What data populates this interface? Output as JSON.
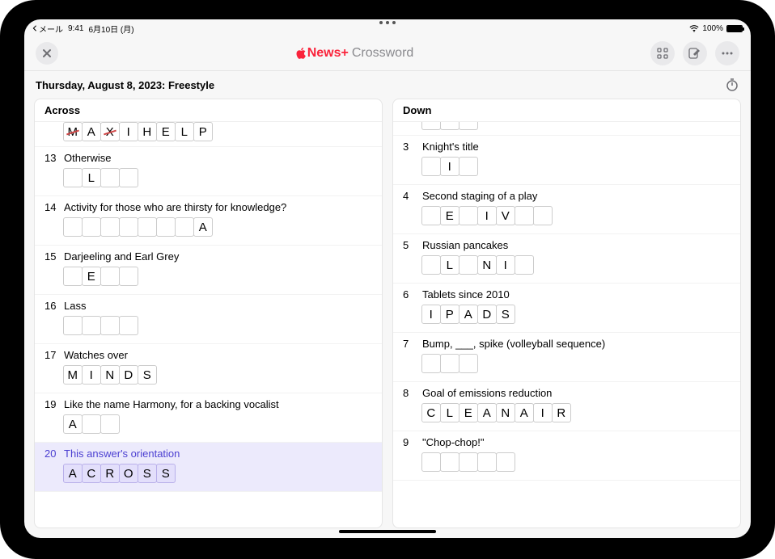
{
  "status": {
    "back_label": "メール",
    "time": "9:41",
    "date": "6月10日 (月)",
    "battery": "100%"
  },
  "nav": {
    "brand": "News+",
    "brand_sub": "Crossword"
  },
  "subtitle": "Thursday, August 8, 2023: Freestyle",
  "across": {
    "header": "Across",
    "clues": [
      {
        "num": "",
        "text": "",
        "letters": [
          "M",
          "A",
          "X",
          "I",
          "H",
          "E",
          "L",
          "P"
        ],
        "struck": [
          0,
          2
        ],
        "nohdr": true
      },
      {
        "num": "13",
        "text": "Otherwise",
        "letters": [
          "",
          "L",
          "",
          ""
        ]
      },
      {
        "num": "14",
        "text": "Activity for those who are thirsty for knowledge?",
        "letters": [
          "",
          "",
          "",
          "",
          "",
          "",
          "",
          "A"
        ]
      },
      {
        "num": "15",
        "text": "Darjeeling and Earl Grey",
        "letters": [
          "",
          "E",
          "",
          ""
        ]
      },
      {
        "num": "16",
        "text": "Lass",
        "letters": [
          "",
          "",
          "",
          ""
        ]
      },
      {
        "num": "17",
        "text": "Watches over",
        "letters": [
          "M",
          "I",
          "N",
          "D",
          "S"
        ]
      },
      {
        "num": "19",
        "text": "Like the name Harmony, for a backing vocalist",
        "letters": [
          "A",
          "",
          ""
        ]
      },
      {
        "num": "20",
        "text": "This answer's orientation",
        "letters": [
          "A",
          "C",
          "R",
          "O",
          "S",
          "S"
        ],
        "active": true
      }
    ]
  },
  "down": {
    "header": "Down",
    "clues": [
      {
        "num": "",
        "text": "",
        "letters": [
          "",
          "",
          ""
        ],
        "partialTop": true,
        "nohdr": true
      },
      {
        "num": "3",
        "text": "Knight's title",
        "letters": [
          "",
          "I",
          ""
        ]
      },
      {
        "num": "4",
        "text": "Second staging of a play",
        "letters": [
          "",
          "E",
          "",
          "I",
          "V",
          "",
          ""
        ]
      },
      {
        "num": "5",
        "text": "Russian pancakes",
        "letters": [
          "",
          "L",
          "",
          "N",
          "I",
          ""
        ]
      },
      {
        "num": "6",
        "text": "Tablets since 2010",
        "letters": [
          "I",
          "P",
          "A",
          "D",
          "S"
        ]
      },
      {
        "num": "7",
        "text": "Bump, ___, spike (volleyball sequence)",
        "letters": [
          "",
          "",
          ""
        ]
      },
      {
        "num": "8",
        "text": "Goal of emissions reduction",
        "letters": [
          "C",
          "L",
          "E",
          "A",
          "N",
          "A",
          "I",
          "R"
        ]
      },
      {
        "num": "9",
        "text": "\"Chop-chop!\"",
        "letters": [
          "",
          "",
          "",
          "",
          ""
        ]
      },
      {
        "num": "",
        "text": "",
        "letters": [],
        "partialBottom": true,
        "nohdr": true
      }
    ]
  }
}
